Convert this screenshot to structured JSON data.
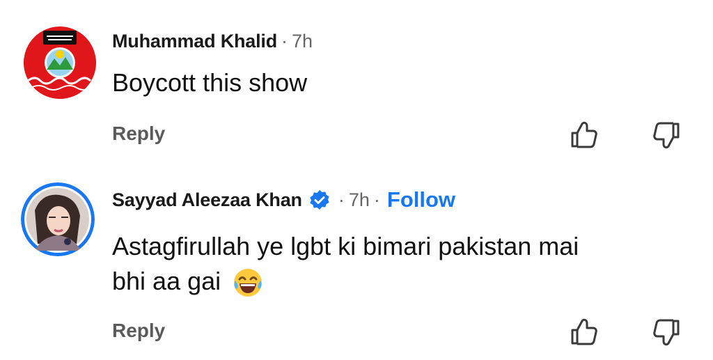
{
  "comments": [
    {
      "author": "Muhammad Khalid",
      "time": "7h",
      "separator": "·",
      "text": "Boycott this show",
      "reply_label": "Reply",
      "avatar_icon": "party-flag-avatar",
      "verified": false
    },
    {
      "author": "Sayyad Aleezaa Khan",
      "time": "7h",
      "separator": "·",
      "follow_label": "Follow",
      "text_line1": "Astagfirullah ye lgbt ki bimari pakistan mai",
      "text_line2": "bhi aa gai",
      "emoji": "face-with-tears-of-joy",
      "reply_label": "Reply",
      "avatar_icon": "profile-photo-avatar",
      "verified": true
    }
  ],
  "colors": {
    "follow": "#1877f2",
    "verified": "#1877f2",
    "meta": "#656565",
    "reply": "#5a5a5a"
  }
}
